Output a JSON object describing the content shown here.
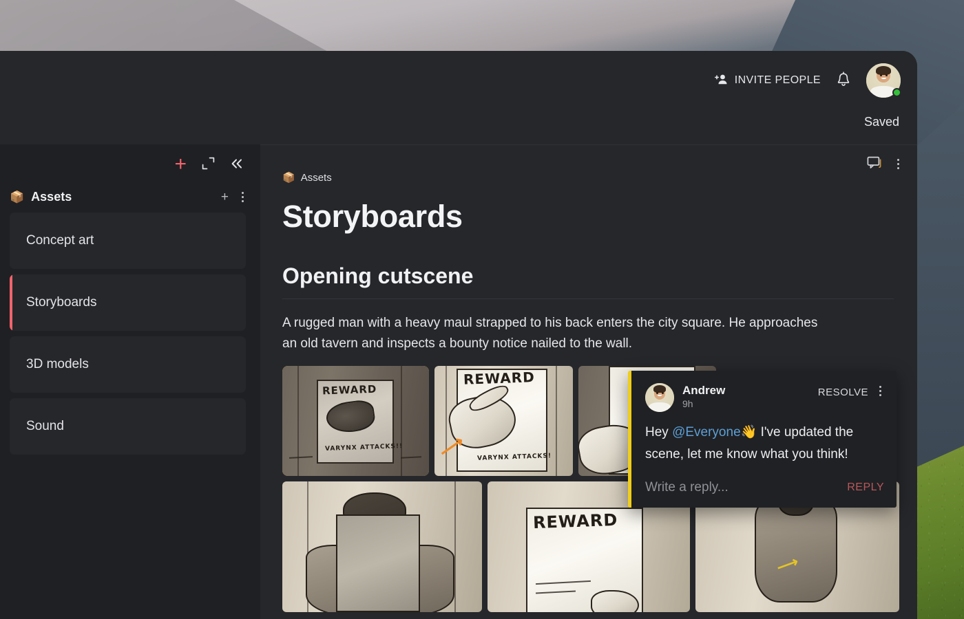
{
  "topbar": {
    "invite_label": "INVITE PEOPLE",
    "invite_icon": "person-add-icon",
    "notifications_icon": "bell-icon",
    "avatar_name": "user-avatar",
    "status": "online",
    "saved_label": "Saved"
  },
  "sidebar": {
    "tools": {
      "add_label": "+",
      "expand_icon": "expand-icon",
      "collapse_icon": "collapse-left-icon"
    },
    "section": {
      "emoji": "📦",
      "title": "Assets",
      "add_label": "+",
      "more_icon": "kebab-menu-icon"
    },
    "items": [
      {
        "label": "Concept art",
        "active": false
      },
      {
        "label": "Storyboards",
        "active": true
      },
      {
        "label": "3D models",
        "active": false
      },
      {
        "label": "Sound",
        "active": false
      }
    ]
  },
  "content": {
    "tools": {
      "comments_icon": "comment-bubble-icon",
      "more_icon": "kebab-menu-icon"
    },
    "breadcrumb": {
      "emoji": "📦",
      "label": "Assets"
    },
    "title": "Storyboards",
    "section_heading": "Opening cutscene",
    "section_body": "A rugged man with a heavy maul strapped to his back enters the city square. He approaches an old tavern and inspects a bounty notice nailed to the wall.",
    "storyboard": {
      "row1": [
        {
          "name": "reward-poster-varynx",
          "caption_title": "REWARD",
          "caption_bottom": "VARYNX ATTACKS!!",
          "selected": true
        },
        {
          "name": "hand-on-poster",
          "caption_title": "REWARD",
          "caption_bottom": "VARYNX ATTACKS!",
          "selected": false
        },
        {
          "name": "hand-on-poster-close",
          "caption_title": "",
          "caption_bottom": "",
          "selected": false
        }
      ],
      "row2": [
        {
          "name": "man-reading-notice",
          "caption_title": "",
          "caption_bottom": "",
          "selected": false
        },
        {
          "name": "reward-poster-closeup",
          "caption_title": "REWARD",
          "caption_bottom": "",
          "selected": false
        },
        {
          "name": "armored-figure",
          "caption_title": "",
          "caption_bottom": "",
          "selected": false
        }
      ]
    }
  },
  "comment": {
    "author": "Andrew",
    "time": "9h",
    "resolve_label": "RESOLVE",
    "more_icon": "kebab-menu-icon",
    "text_before": "Hey ",
    "mention": "@Everyone",
    "emoji": "👋",
    "text_after": " I've updated the scene, let me know what you think!",
    "reply_placeholder": "Write a reply...",
    "reply_label": "REPLY",
    "accent_color": "#f0cd1a"
  },
  "colors": {
    "accent_red": "#f2636c",
    "selection_yellow": "#d8c81a",
    "mention_blue": "#5c9fd6",
    "online_green": "#34c13a",
    "reply_red": "#b8585c"
  }
}
